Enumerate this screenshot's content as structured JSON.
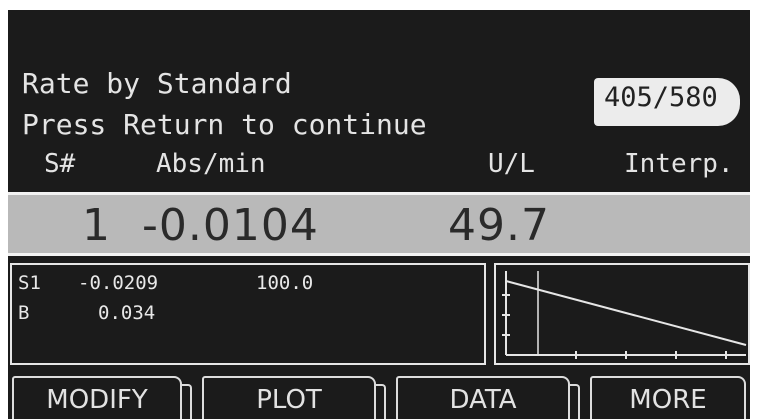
{
  "prompt": {
    "line1": "Rate by Standard",
    "line2": "Press Return to continue"
  },
  "wavelength_badge": "405/580",
  "columns": {
    "sample": "S#",
    "abs": "Abs/min",
    "units": "U/L",
    "mode": "Interp."
  },
  "result": {
    "sample_no": "1",
    "abs_per_min": "-0.0104",
    "concentration": "49.7"
  },
  "standards": [
    {
      "id": "S1",
      "abs": "-0.0209",
      "conc": "100.0"
    },
    {
      "id": "B",
      "abs": "0.034",
      "conc": ""
    }
  ],
  "plot": {
    "type": "line",
    "points": [
      {
        "x": 0,
        "y": 1.0
      },
      {
        "x": 1.0,
        "y": 0.0
      }
    ]
  },
  "softkeys": {
    "modify": "MODIFY",
    "plot": "PLOT",
    "data": "DATA",
    "more": "MORE"
  }
}
